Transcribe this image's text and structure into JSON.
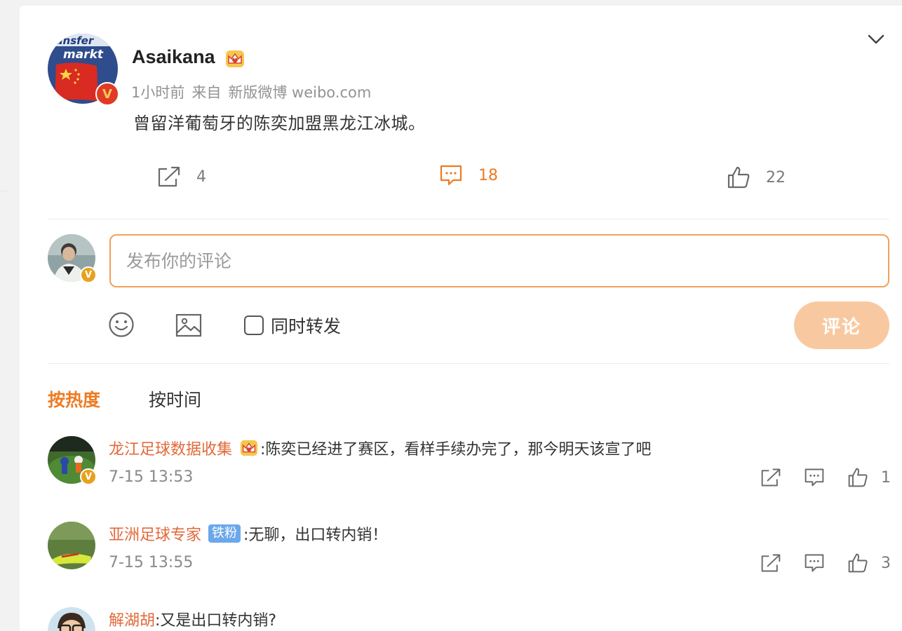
{
  "post": {
    "author": "Asaikana",
    "avatar_text_top": "ransfer",
    "avatar_text_bottom": "markt",
    "avatar_badge": "V",
    "time": "1小时前",
    "source_prefix": "来自",
    "source": "新版微博 weibo.com",
    "content": "曾留洋葡萄牙的陈奕加盟黑龙江冰城。",
    "reposts": "4",
    "comments": "18",
    "likes": "22"
  },
  "composer": {
    "placeholder": "发布你的评论",
    "repost_label": "同时转发",
    "submit_label": "评论",
    "avatar_badge": "V"
  },
  "sort_tabs": {
    "hot": "按热度",
    "time": "按时间"
  },
  "comments": [
    {
      "user": "龙江足球数据收集",
      "text": ":陈奕已经进了赛区，看样手续办完了，那今明天该宣了吧",
      "time": "7-15 13:53",
      "likes": "1",
      "avatar_badge": "V"
    },
    {
      "user": "亚洲足球专家",
      "badge": "铁粉",
      "text": ":无聊，出口转内销！",
      "time": "7-15 13:55",
      "likes": "3"
    },
    {
      "user": "解湖胡",
      "text": ":又是出口转内销?"
    }
  ],
  "colors": {
    "accent": "#ee7b22",
    "username_link": "#e2693a",
    "submit_disabled": "#f8c9a0",
    "fan_badge": "#6ba8ea",
    "verified_gold": "#e8a11d"
  },
  "icons": [
    "chevron-down-icon",
    "repost-icon",
    "comment-icon",
    "like-icon",
    "emoji-icon",
    "image-icon",
    "crown-icon"
  ]
}
